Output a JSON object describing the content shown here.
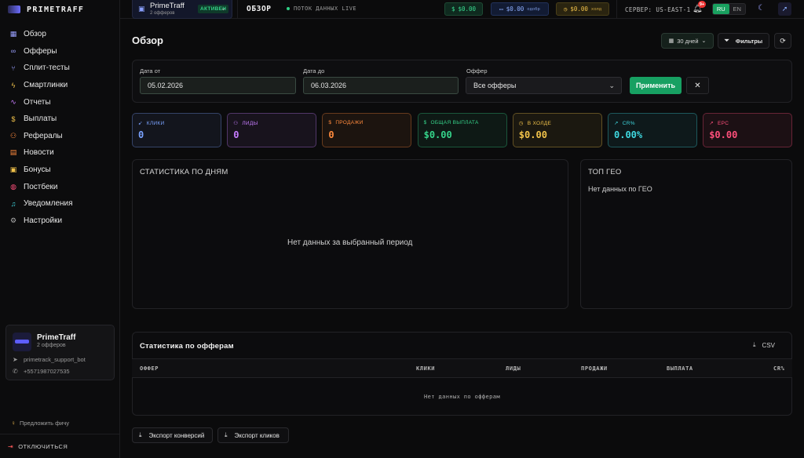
{
  "brand": {
    "name": "PRIMETRAFF"
  },
  "sidebar": {
    "items": [
      {
        "label": "Обзор",
        "icon": "grid-icon"
      },
      {
        "label": "Офферы",
        "icon": "link-icon"
      },
      {
        "label": "Сплит-тесты",
        "icon": "split-icon"
      },
      {
        "label": "Смартлинки",
        "icon": "bolt-icon"
      },
      {
        "label": "Отчеты",
        "icon": "activity-icon"
      },
      {
        "label": "Выплаты",
        "icon": "dollar-icon"
      },
      {
        "label": "Рефералы",
        "icon": "users-icon"
      },
      {
        "label": "Новости",
        "icon": "newspaper-icon"
      },
      {
        "label": "Бонусы",
        "icon": "gift-icon"
      },
      {
        "label": "Постбеки",
        "icon": "globe-icon"
      },
      {
        "label": "Уведомления",
        "icon": "bell-icon"
      },
      {
        "label": "Настройки",
        "icon": "gear-icon"
      }
    ],
    "bot_card": {
      "title": "PrimeTraff",
      "subtitle": "2 офферов",
      "telegram": "primetrack_support_bot",
      "phone": "+5571987027535"
    },
    "suggest": "Предложить фичу",
    "logout": "ОТКЛЮЧИТЬСЯ"
  },
  "topbar": {
    "offer_name": "PrimeTraff",
    "offer_count": "2 офферов",
    "status_badge": "АКТИВЕН",
    "section": "ОБЗОР",
    "live": "ПОТОК ДАННЫХ LIVE",
    "balance_green": "$0.00",
    "balance_blue": "$0.00",
    "balance_blue_note": "одобр",
    "balance_yellow": "$0.00",
    "balance_yellow_note": "холд",
    "server": "СЕРВЕР: US-EAST-1",
    "notif_count": "9+",
    "lang_ru": "RU",
    "lang_en": "EN"
  },
  "page": {
    "title": "Обзор",
    "period": "30 дней",
    "filters": "Фильтры"
  },
  "filters": {
    "date_from_label": "Дата от",
    "date_from": "05.02.2026",
    "date_to_label": "Дата до",
    "date_to": "06.03.2026",
    "offer_label": "Оффер",
    "offer_value": "Все офферы",
    "apply": "Применить"
  },
  "kpis": [
    {
      "label": "КЛИКИ",
      "value": "0",
      "icon": "cursor-icon",
      "color": "#7aa2ff"
    },
    {
      "label": "ЛИДЫ",
      "value": "0",
      "icon": "users-icon",
      "color": "#c77dff"
    },
    {
      "label": "ПРОДАЖИ",
      "value": "0",
      "icon": "dollar-icon",
      "color": "#ff8a3d"
    },
    {
      "label": "ОБЩАЯ ВЫПЛАТА",
      "value": "$0.00",
      "icon": "dollar-icon",
      "color": "#35d38a"
    },
    {
      "label": "В ХОЛДЕ",
      "value": "$0.00",
      "icon": "clock-icon",
      "color": "#f1c24a"
    },
    {
      "label": "CR%",
      "value": "0.00%",
      "icon": "trend-icon",
      "color": "#3fd8e0"
    },
    {
      "label": "EPC",
      "value": "$0.00",
      "icon": "trend-icon",
      "color": "#ff4f7b"
    }
  ],
  "daily": {
    "title": "СТАТИСТИКА ПО ДНЯМ",
    "empty": "Нет данных за выбранный период"
  },
  "geo": {
    "title": "ТОП ГЕО",
    "empty": "Нет данных по ГЕО"
  },
  "offers_table": {
    "title": "Статистика по офферам",
    "csv": "CSV",
    "columns": [
      "ОФФЕР",
      "КЛИКИ",
      "ЛИДЫ",
      "ПРОДАЖИ",
      "ВЫПЛАТА",
      "CR%"
    ],
    "empty": "Нет данных по офферам"
  },
  "exports": {
    "conversions": "Экспорт конверсий",
    "clicks": "Экспорт кликов"
  }
}
